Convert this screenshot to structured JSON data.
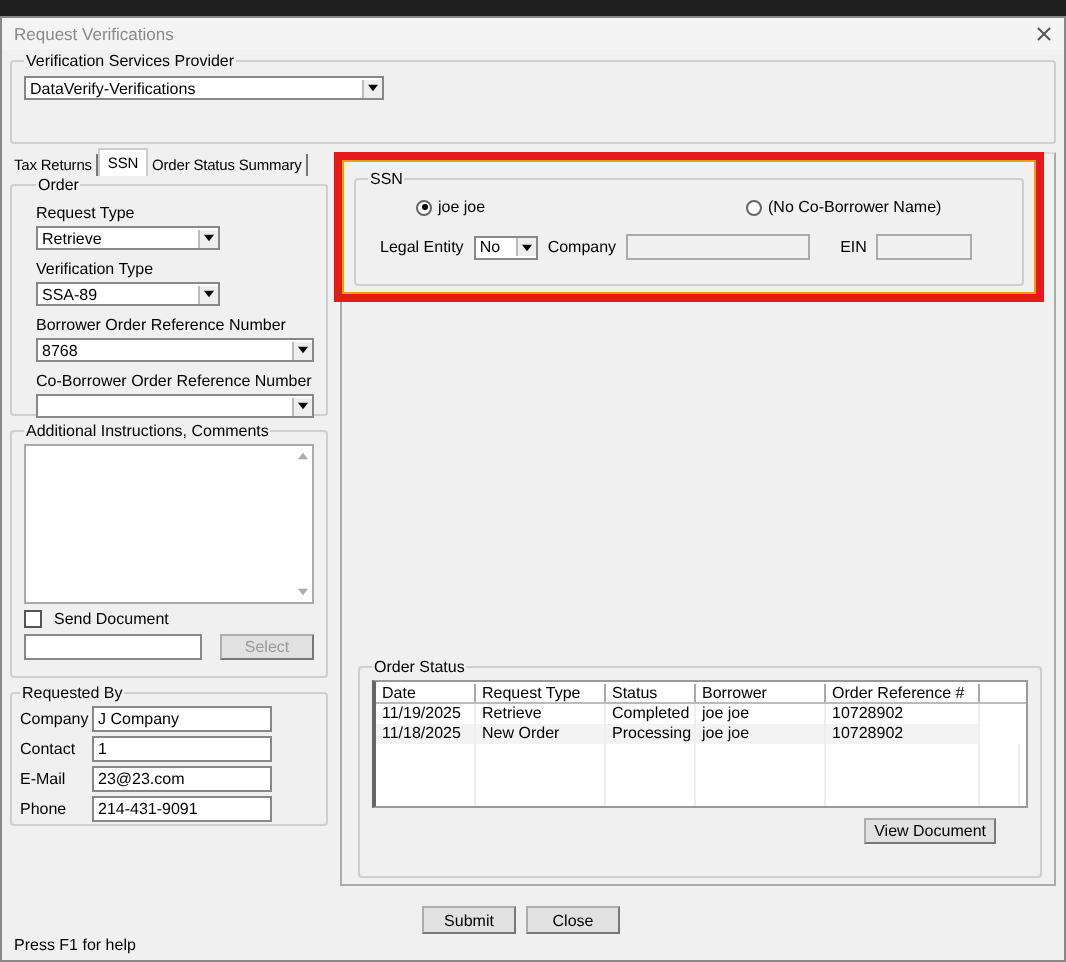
{
  "window": {
    "title": "Request Verifications"
  },
  "provider": {
    "label": "Verification Services Provider",
    "value": "DataVerify-Verifications"
  },
  "tabs": [
    {
      "label": "Tax Returns",
      "selected": false
    },
    {
      "label": "SSN",
      "selected": true
    },
    {
      "label": "Order Status Summary",
      "selected": false
    }
  ],
  "order": {
    "title": "Order",
    "fields": [
      {
        "label": "Request Type",
        "value": "Retrieve",
        "kind": "short"
      },
      {
        "label": "Verification Type",
        "value": "SSA-89",
        "kind": "short"
      },
      {
        "label": "Borrower Order Reference Number",
        "value": "8768",
        "kind": "long"
      },
      {
        "label": "Co-Borrower Order Reference Number",
        "kind": "long"
      }
    ]
  },
  "comments": {
    "title": "Additional Instructions, Comments",
    "send_document": {
      "label": "Send Document",
      "checked": false
    },
    "select_button": {
      "label": "Select",
      "disabled": true
    }
  },
  "requested_by": {
    "title": "Requested By",
    "fields": [
      {
        "label": "Company",
        "value": "J Company"
      },
      {
        "label": "Contact",
        "value": "1"
      },
      {
        "label": "E-Mail",
        "value": "23@23.com"
      },
      {
        "label": "Phone",
        "value": "214-431-9091"
      }
    ]
  },
  "ssn": {
    "title": "SSN",
    "highlighted": true,
    "borrowers": [
      {
        "label": "joe joe",
        "selected": true
      },
      {
        "label": "(No Co-Borrower Name)",
        "selected": false
      }
    ],
    "legal_entity": {
      "label": "Legal Entity",
      "value": "No"
    },
    "company": {
      "label": "Company"
    },
    "ein": {
      "label": "EIN"
    }
  },
  "order_status": {
    "title": "Order Status",
    "columns": [
      "Date",
      "Request Type",
      "Status",
      "Borrower",
      "Order Reference #"
    ],
    "rows": [
      [
        "11/19/2025",
        "Retrieve",
        "Completed",
        "joe joe",
        "10728902"
      ],
      [
        "11/18/2025",
        "New Order",
        "Processing",
        "joe joe",
        "10728902"
      ]
    ],
    "view_button": "View Document"
  },
  "buttons": [
    "Submit",
    "Close"
  ],
  "status_bar": "Press F1 for help"
}
